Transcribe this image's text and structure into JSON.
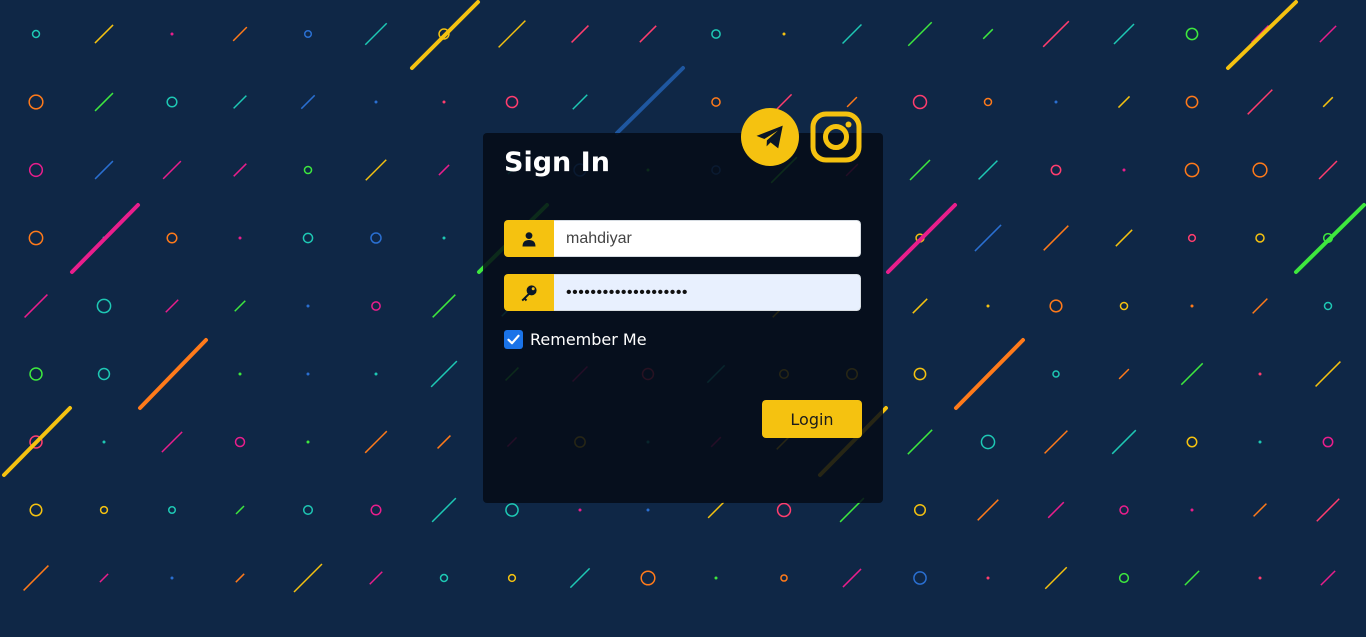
{
  "page": {
    "background": "#0f2746"
  },
  "card": {
    "title": "Sign In",
    "background": "#050c16"
  },
  "social": {
    "telegram": {
      "icon": "telegram-icon",
      "color": "#f5c210"
    },
    "instagram": {
      "icon": "instagram-icon",
      "color": "#f5c210"
    }
  },
  "form": {
    "username": {
      "icon": "user-icon",
      "value": "mahdiyar"
    },
    "password": {
      "icon": "key-icon",
      "value": "••••••••••••••••••••"
    },
    "remember": {
      "label": "Remember Me",
      "checked": true
    },
    "login_label": "Login"
  },
  "colors": {
    "accent": "#f5c210",
    "checkbox": "#1a73e8",
    "confetti": [
      "#e91e8c",
      "#f5c210",
      "#3ee83e",
      "#1ec8b4",
      "#ff7a1a",
      "#2a6fd1",
      "#ff3d6e"
    ]
  }
}
